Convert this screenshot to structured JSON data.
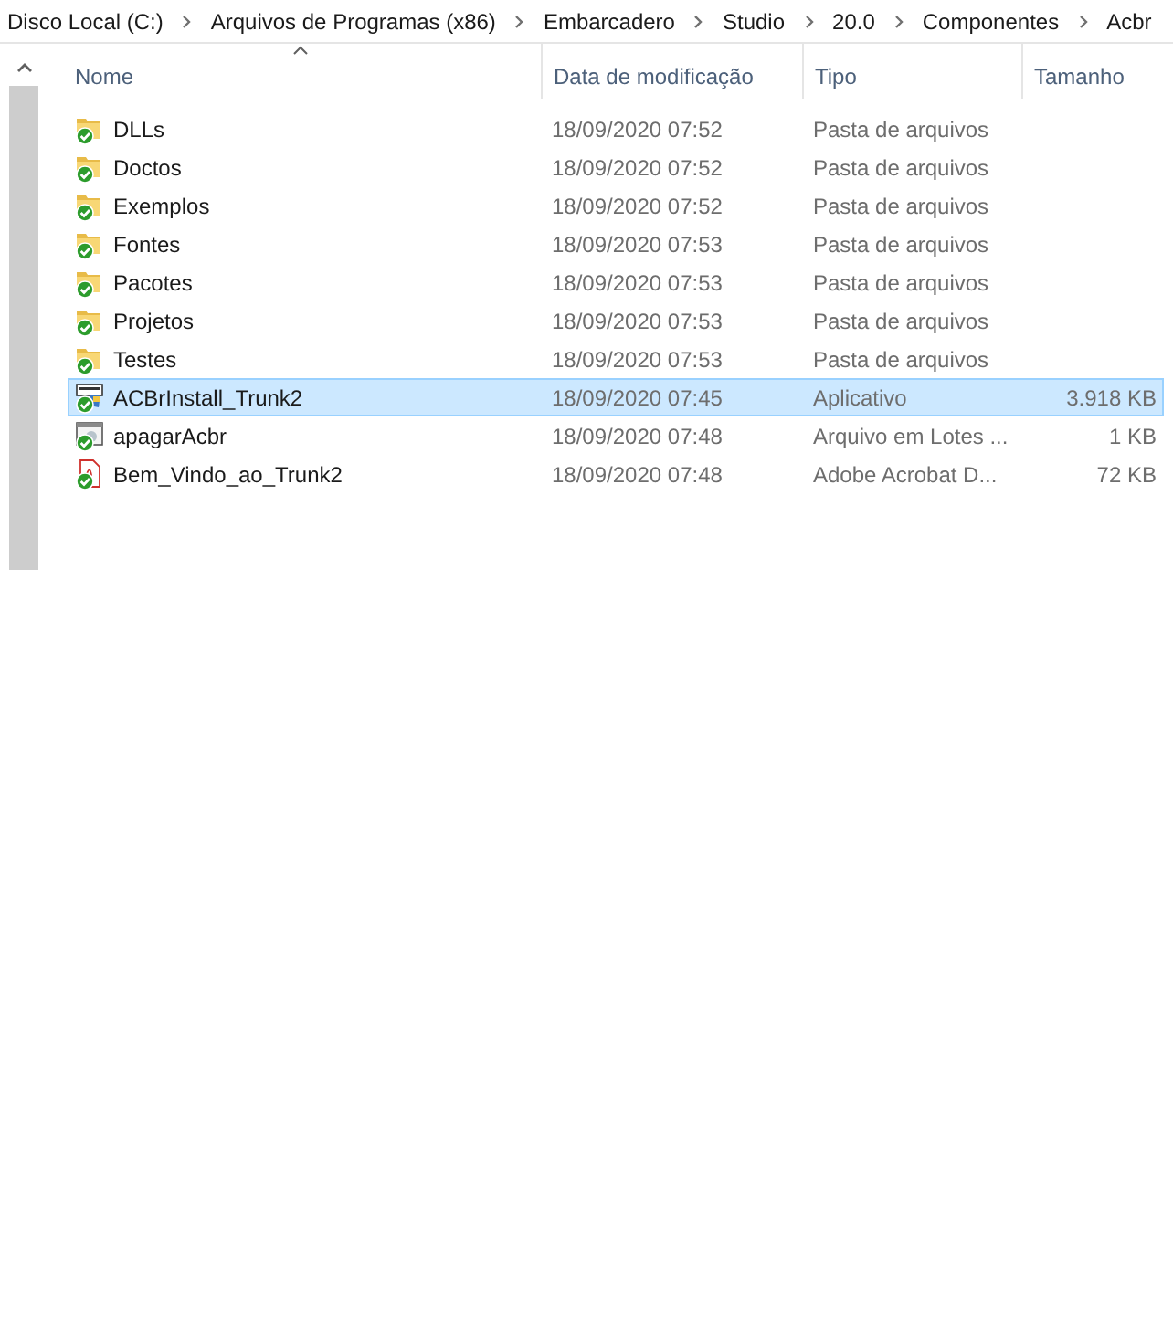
{
  "breadcrumb": [
    "Disco Local (C:)",
    "Arquivos de Programas (x86)",
    "Embarcadero",
    "Studio",
    "20.0",
    "Componentes",
    "Acbr"
  ],
  "columns": [
    {
      "label": "Nome",
      "sorted": true
    },
    {
      "label": "Data de modificação",
      "sorted": false
    },
    {
      "label": "Tipo",
      "sorted": false
    },
    {
      "label": "Tamanho",
      "sorted": false
    }
  ],
  "rows": [
    {
      "kind": "folder",
      "name": "DLLs",
      "date": "18/09/2020 07:52",
      "type": "Pasta de arquivos",
      "selected": false
    },
    {
      "kind": "folder",
      "name": "Doctos",
      "date": "18/09/2020 07:52",
      "type": "Pasta de arquivos",
      "selected": false
    },
    {
      "kind": "folder",
      "name": "Exemplos",
      "date": "18/09/2020 07:52",
      "type": "Pasta de arquivos",
      "selected": false
    },
    {
      "kind": "folder",
      "name": "Fontes",
      "date": "18/09/2020 07:53",
      "type": "Pasta de arquivos",
      "selected": false
    },
    {
      "kind": "folder",
      "name": "Pacotes",
      "date": "18/09/2020 07:53",
      "type": "Pasta de arquivos",
      "selected": false
    },
    {
      "kind": "folder",
      "name": "Projetos",
      "date": "18/09/2020 07:53",
      "type": "Pasta de arquivos",
      "selected": false
    },
    {
      "kind": "folder",
      "name": "Testes",
      "date": "18/09/2020 07:53",
      "type": "Pasta de arquivos",
      "selected": false
    },
    {
      "kind": "app",
      "name": "ACBrInstall_Trunk2",
      "date": "18/09/2020 07:45",
      "type": "Aplicativo",
      "size": "3.918 KB",
      "selected": true
    },
    {
      "kind": "batch",
      "name": "apagarAcbr",
      "date": "18/09/2020 07:48",
      "type": "Arquivo em Lotes ...",
      "size": "1 KB",
      "selected": false
    },
    {
      "kind": "pdf",
      "name": "Bem_Vindo_ao_Trunk2",
      "date": "18/09/2020 07:48",
      "type": "Adobe Acrobat D...",
      "size": "72 KB",
      "selected": false
    }
  ]
}
